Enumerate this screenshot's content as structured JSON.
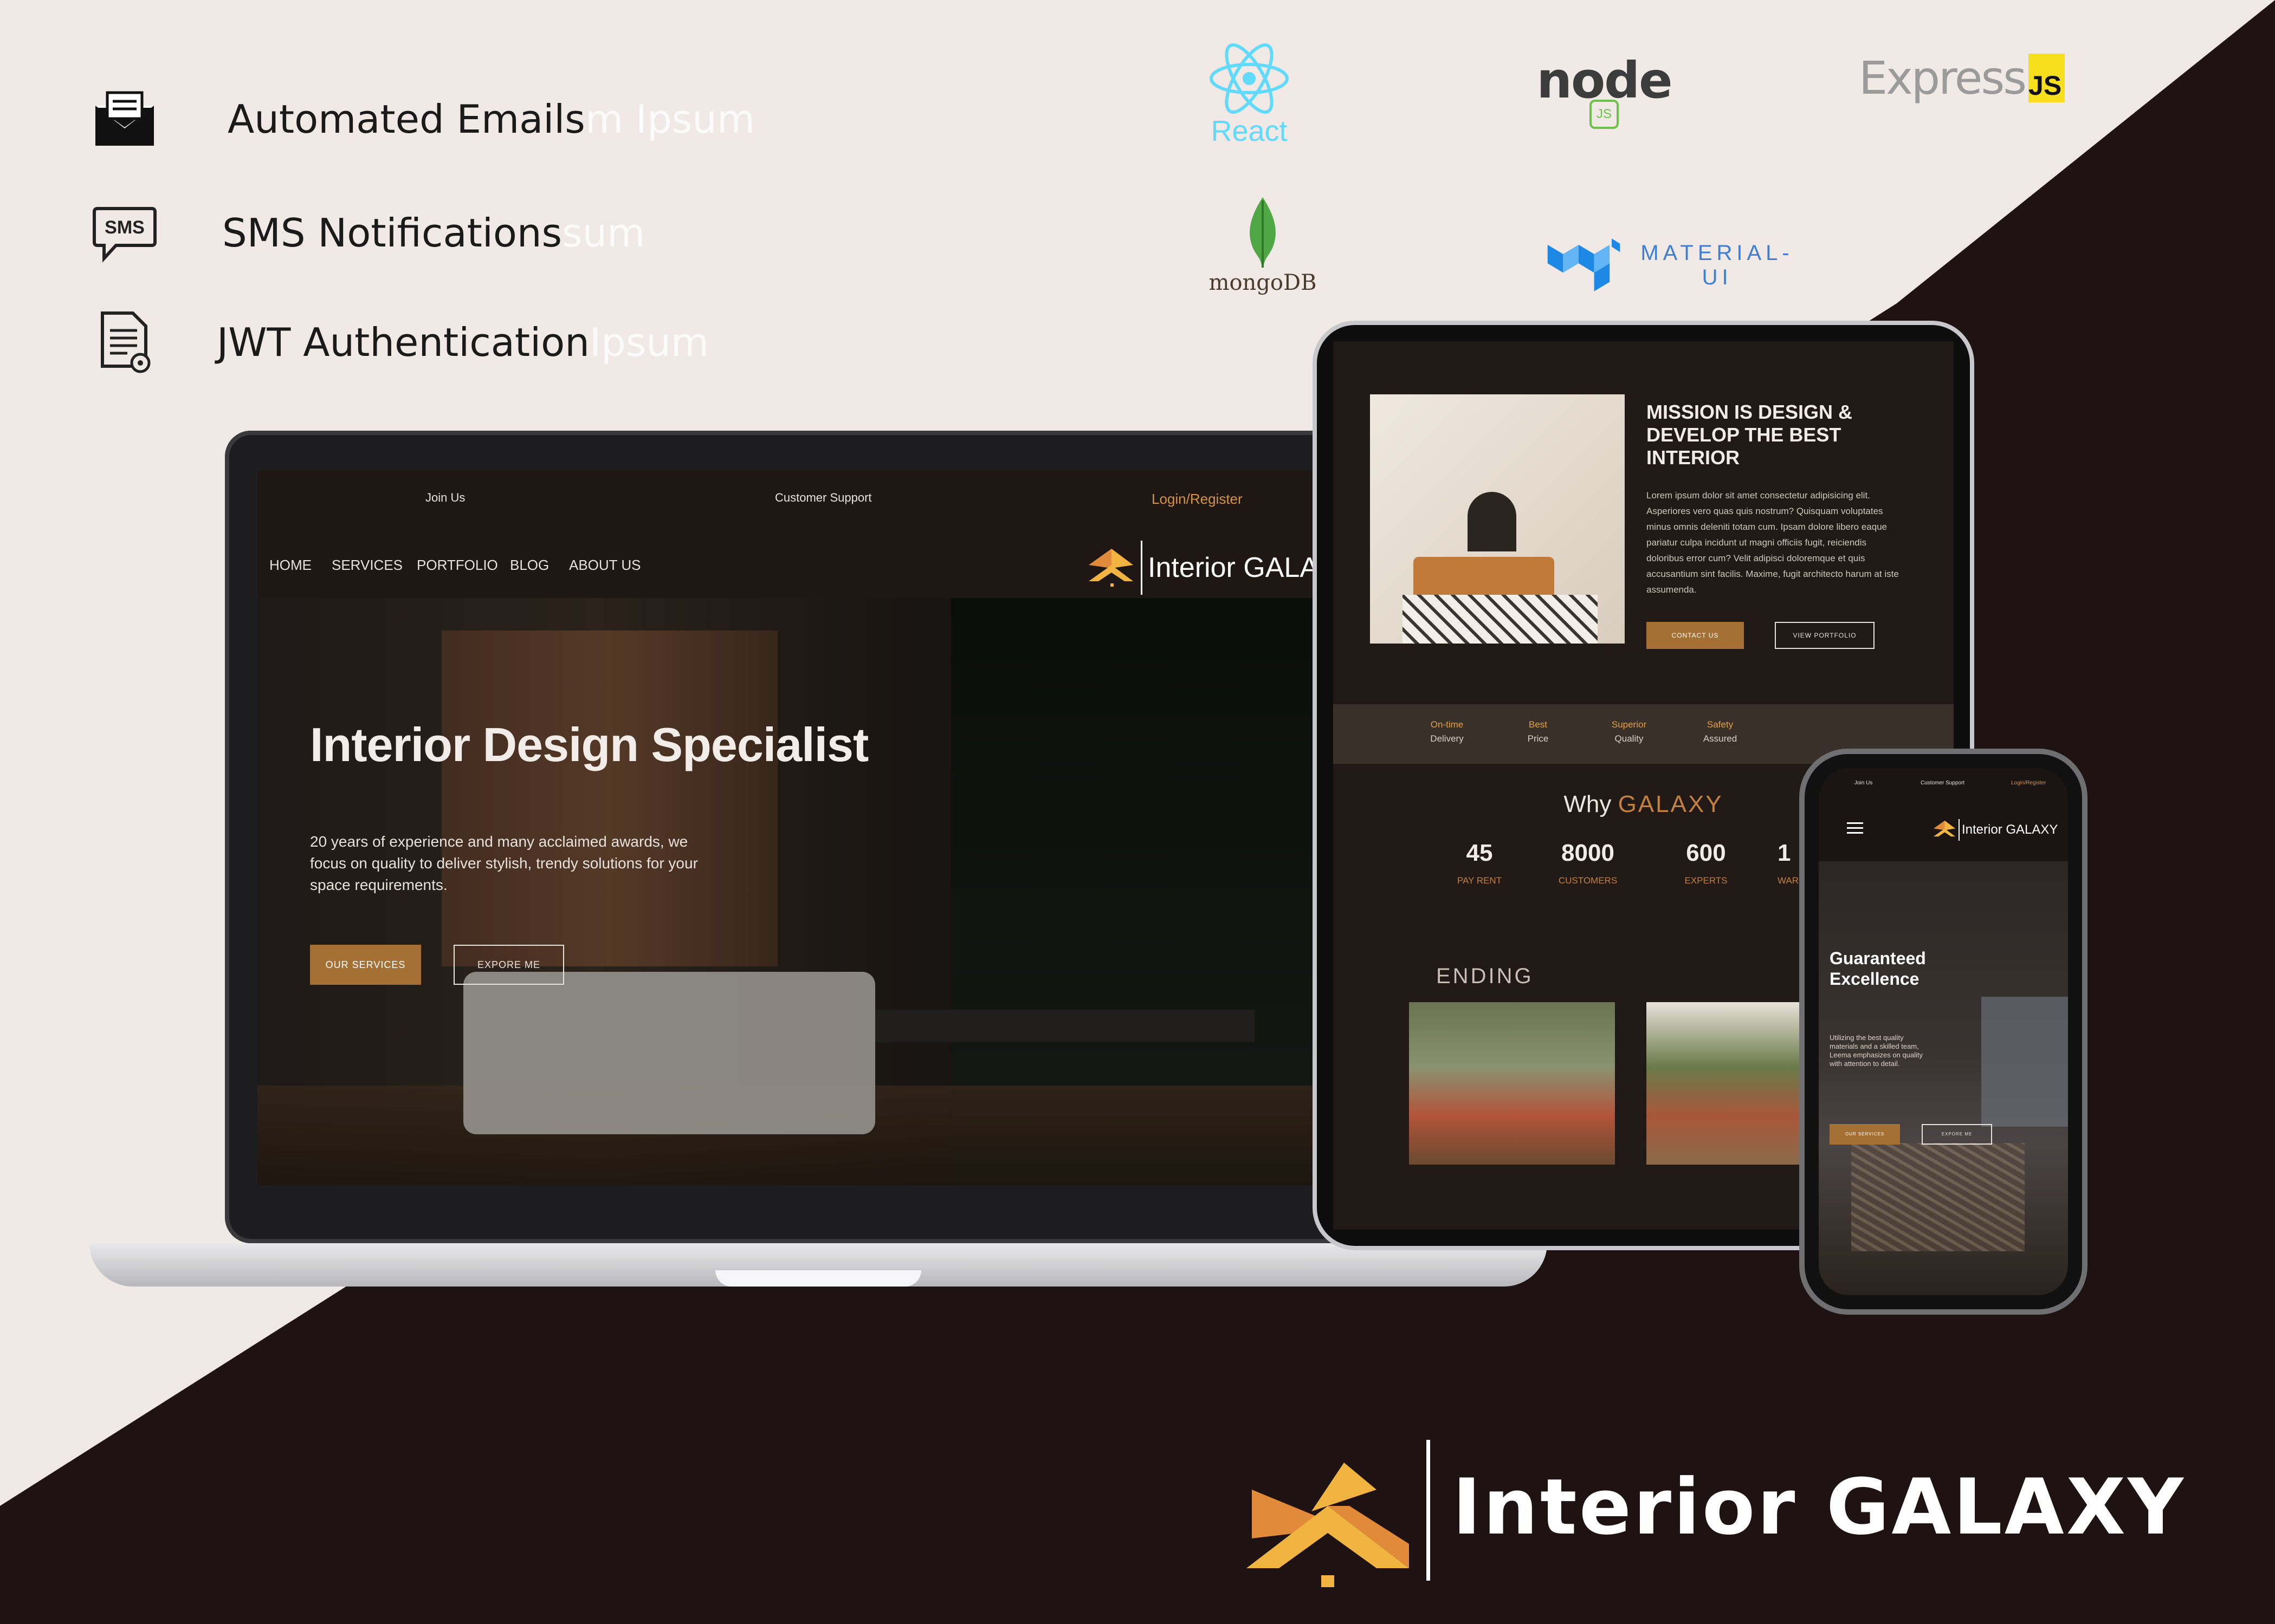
{
  "features": [
    {
      "icon": "envelope-icon",
      "label": "Automated Emails",
      "ghost": "m Ipsum"
    },
    {
      "icon": "sms-bubble-icon",
      "label": "SMS Notifications",
      "ghost": "sum"
    },
    {
      "icon": "document-lock-icon",
      "label": "JWT Authentication",
      "ghost": "Ipsum"
    }
  ],
  "tech": {
    "react": "React",
    "node": "node",
    "node_js": "JS",
    "express": "Express",
    "express_js": "JS",
    "mongo": "mongoDB",
    "mui": "MATERIAL-UI"
  },
  "laptop": {
    "top_links": {
      "join": "Join Us",
      "support": "Customer Support",
      "login": "Login/Register"
    },
    "nav": [
      "HOME",
      "SERVICES",
      "PORTFOLIO",
      "BLOG",
      "ABOUT US"
    ],
    "brand": "Interior GALAXY",
    "hero_title": "Interior Design Specialist",
    "hero_sub": "20 years of experience and many acclaimed awards, we focus on quality to deliver stylish, trendy solutions for your space requirements.",
    "btn_services": "OUR SERVICES",
    "btn_explore": "EXPORE ME"
  },
  "tablet": {
    "mission_title": "MISSION IS DESIGN & DEVELOP THE BEST INTERIOR",
    "mission_body": "Lorem ipsum dolor sit amet consectetur adipisicing elit. Asperiores vero quas quis nostrum? Quisquam voluptates minus omnis deleniti totam cum. Ipsam dolore libero eaque pariatur culpa incidunt ut magni officiis fugit, reiciendis doloribus error cum? Velit adipisci doloremque et quis accusantium sint facilis. Maxime, fugit architecto harum at iste assumenda.",
    "btn_contact": "CONTACT US",
    "btn_portfolio": "VIEW PORTFOLIO",
    "features": [
      {
        "a": "On-time",
        "b": "Delivery"
      },
      {
        "a": "Best",
        "b": "Price"
      },
      {
        "a": "Superior",
        "b": "Quality"
      },
      {
        "a": "Safety",
        "b": "Assured"
      }
    ],
    "why": "Why",
    "why_brand": "GALAXY",
    "stats": [
      {
        "value": "45",
        "label": "PAY RENT"
      },
      {
        "value": "8000",
        "label": "CUSTOMERS"
      },
      {
        "value": "600",
        "label": "EXPERTS"
      },
      {
        "value": "1",
        "label": "WAR"
      }
    ],
    "trending": "ENDING"
  },
  "phone": {
    "top_links": {
      "join": "Join Us",
      "support": "Customer Support",
      "login": "Login/Register"
    },
    "brand": "Interior GALAXY",
    "hero_title": "Guaranteed Excellence",
    "hero_sub": "Utilizing the best quality materials and a skilled team, Leema emphasizes on quality with attention to detail.",
    "btn_services": "OUR SERVICES",
    "btn_explore": "EXPORE ME"
  },
  "brand_footer": "Interior GALAXY",
  "colors": {
    "gold": "#a57034",
    "dark": "#1e1213",
    "cream": "#f0e9e5",
    "accent_orange": "#e08a3a",
    "accent_yellow": "#f2b441"
  }
}
